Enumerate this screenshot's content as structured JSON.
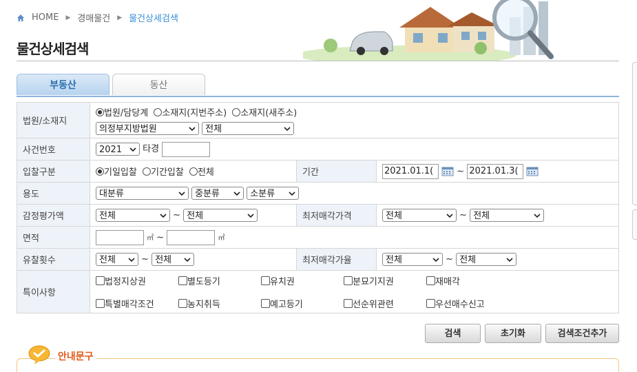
{
  "breadcrumb": {
    "home": "HOME",
    "level1": "경매물건",
    "current": "물건상세검색"
  },
  "page_title": "물건상세검색",
  "tabs": [
    {
      "label": "부동산"
    },
    {
      "label": "동산"
    }
  ],
  "form": {
    "court": {
      "label": "법원/소재지",
      "radios": [
        "법원/담당계",
        "소재지(지번주소)",
        "소재지(새주소)"
      ],
      "court_select": "의정부지방법원",
      "dept_select": "전체"
    },
    "case_no": {
      "label": "사건번호",
      "year": "2021",
      "type_label": "타경",
      "number": ""
    },
    "bid_type": {
      "label": "입찰구분",
      "radios": [
        "기일입찰",
        "기간입찰",
        "전체"
      ]
    },
    "period": {
      "label": "기간",
      "from": "2021.01.1(",
      "tilde": "~",
      "to": "2021.01.3("
    },
    "usage": {
      "label": "용도",
      "major": "대분류",
      "middle": "중분류",
      "minor": "소분류"
    },
    "appraisal": {
      "label": "감정평가액",
      "from": "전체",
      "to": "전체",
      "tilde": "~"
    },
    "min_price": {
      "label": "최저매각가격",
      "from": "전체",
      "to": "전체",
      "tilde": "~"
    },
    "area": {
      "label": "면적",
      "unit": "㎡",
      "tilde": "~"
    },
    "fail_count": {
      "label": "유찰횟수",
      "from": "전체",
      "to": "전체",
      "tilde": "~"
    },
    "min_rate": {
      "label": "최저매각가율",
      "from": "전체",
      "to": "전체",
      "tilde": "~"
    },
    "special": {
      "label": "특이사항",
      "row1": [
        "법정지상권",
        "별도등기",
        "유치권",
        "분묘기지권",
        "재매각"
      ],
      "row2": [
        "특별매각조건",
        "농지취득",
        "예고등기",
        "선순위관련",
        "우선매수신고"
      ]
    }
  },
  "buttons": {
    "search": "검색",
    "reset": "초기화",
    "add_condition": "검색조건추가"
  },
  "guide": {
    "title": "안내문구"
  }
}
